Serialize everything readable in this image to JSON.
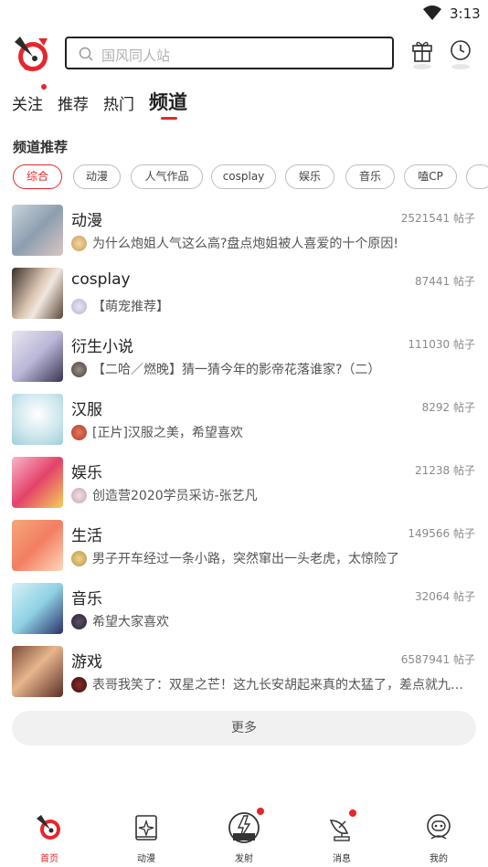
{
  "status_bar": {
    "time": "3:13"
  },
  "search": {
    "placeholder": "国风同人站"
  },
  "top_tabs": [
    {
      "label": "关注",
      "has_dot": true
    },
    {
      "label": "推荐"
    },
    {
      "label": "热门"
    },
    {
      "label": "频道",
      "active": true
    }
  ],
  "section_title": "频道推荐",
  "chips": [
    {
      "label": "综合",
      "active": true
    },
    {
      "label": "动漫"
    },
    {
      "label": "人气作品"
    },
    {
      "label": "cosplay"
    },
    {
      "label": "娱乐"
    },
    {
      "label": "音乐"
    },
    {
      "label": "嗑CP"
    }
  ],
  "channels": [
    {
      "name": "动漫",
      "count": "2521541 帖子",
      "post": "为什么炮姐人气这么高?盘点炮姐被人喜爱的十个原因!"
    },
    {
      "name": "cosplay",
      "count": "87441 帖子",
      "post": "【萌宠推荐】"
    },
    {
      "name": "衍生小说",
      "count": "111030 帖子",
      "post": "【二哈／燃晚】猜一猜今年的影帝花落谁家?（二）"
    },
    {
      "name": "汉服",
      "count": "8292 帖子",
      "post": "[正片]汉服之美，希望喜欢"
    },
    {
      "name": "娱乐",
      "count": "21238 帖子",
      "post": "创造营2020学员采访-张艺凡"
    },
    {
      "name": "生活",
      "count": "149566 帖子",
      "post": "男子开车经过一条小路，突然窜出一头老虎，太惊险了"
    },
    {
      "name": "音乐",
      "count": "32064 帖子",
      "post": "希望大家喜欢"
    },
    {
      "name": "游戏",
      "count": "6587941 帖子",
      "post": "表哥我笑了：双星之芒！这九长安胡起来真的太猛了，差点就九…"
    }
  ],
  "more_label": "更多",
  "bottom_nav": [
    {
      "label": "首页",
      "icon": "home-rocket-icon",
      "active": true
    },
    {
      "label": "动漫",
      "icon": "book-icon"
    },
    {
      "label": "发射",
      "icon": "launch-icon",
      "has_dot": true
    },
    {
      "label": "消息",
      "icon": "satellite-icon",
      "has_dot": true
    },
    {
      "label": "我的",
      "icon": "astronaut-icon"
    }
  ],
  "colors": {
    "accent": "#e5262b"
  }
}
